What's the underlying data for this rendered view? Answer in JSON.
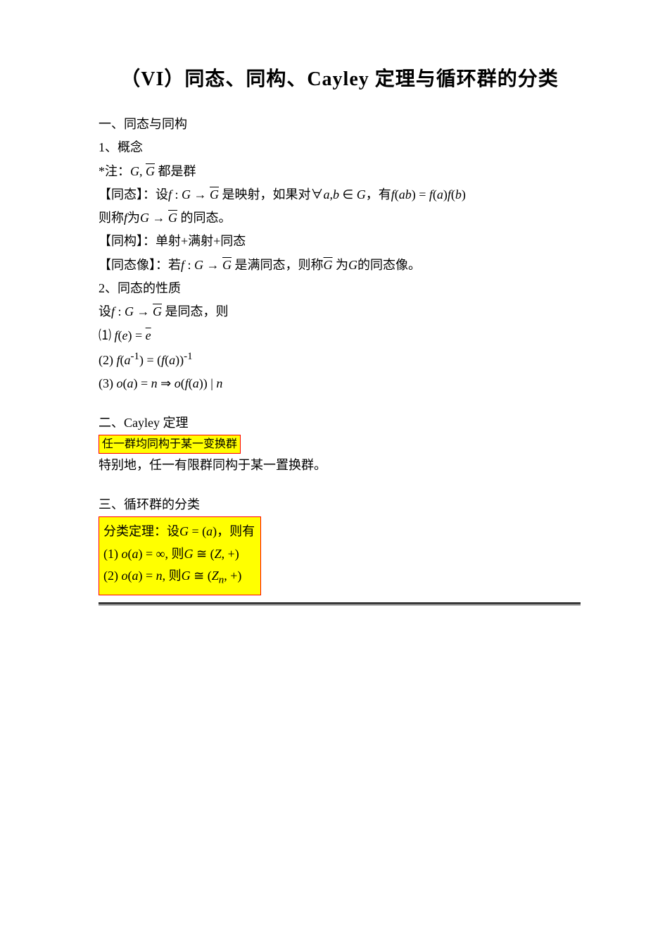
{
  "title": "（VI）同态、同构、Cayley 定理与循环群的分类",
  "s1": {
    "heading": "一、同态与同构",
    "p1": "1、概念",
    "note": "*注：G, G 都是群",
    "note_html": "*注：<span class='math-i'>G</span>, <span class='math-i ov'>G</span> 都是群",
    "homdef_l1": "【同态】：设<span class='math-i'>f</span> : <span class='math-i'>G</span> → <span class='math-i ov'>G</span> 是映射，如果对∀<span class='math-i'>a</span>,<span class='math-i'>b</span> ∈ <span class='math-i'>G</span>，有<span class='math-i'>f</span>(<span class='math-i'>ab</span>) = <span class='math-i'>f</span>(<span class='math-i'>a</span>)<span class='math-i'>f</span>(<span class='math-i'>b</span>)",
    "homdef_l2": "则称<span class='math-i'>f</span>为<span class='math-i'>G</span> → <span class='math-i ov'>G</span> 的同态。",
    "iso": "【同构】：单射+满射+同态",
    "homimg": "【同态像】：若<span class='math-i'>f</span> : <span class='math-i'>G</span> → <span class='math-i ov'>G</span> 是满同态，则称<span class='math-i ov'>G</span> 为<span class='math-i'>G</span>的同态像。",
    "p2": "2、同态的性质",
    "prop_pre": "设<span class='math-i'>f</span> : <span class='math-i'>G</span> → <span class='math-i ov'>G</span> 是同态，则",
    "prop1": "⑴ <span class='math-i'>f</span>(<span class='math-i'>e</span>) = <span class='math-i ov'>e</span>",
    "prop2": "(2) <span class='math-i'>f</span>(<span class='math-i'>a</span><sup>-1</sup>) = (<span class='math-i'>f</span>(<span class='math-i'>a</span>))<sup>-1</sup>",
    "prop3": "(3) <span class='math-i'>o</span>(<span class='math-i'>a</span>) = <span class='math-i'>n</span> ⇒ <span class='math-i'>o</span>(<span class='math-i'>f</span>(<span class='math-i'>a</span>)) | <span class='math-i'>n</span>"
  },
  "s2": {
    "heading": "二、Cayley 定理",
    "boxed": "任一群均同构于某一变换群",
    "after": "特别地，任一有限群同构于某一置换群。"
  },
  "s3": {
    "heading": "三、循环群的分类",
    "box_l1": "分类定理：设<span class='math-i'>G</span> = (<span class='math-i'>a</span>)，则有",
    "box_l2": "(1) <span class='math-i'>o</span>(<span class='math-i'>a</span>) = ∞, 则<span class='math-i'>G</span> ≅ (<span class='math-i'>Z</span>, +)",
    "box_l3": "(2) <span class='math-i'>o</span>(<span class='math-i'>a</span>) = <span class='math-i'>n</span>, 则<span class='math-i'>G</span> ≅ (<span class='math-i'>Z<sub>n</sub></span>, +)"
  }
}
